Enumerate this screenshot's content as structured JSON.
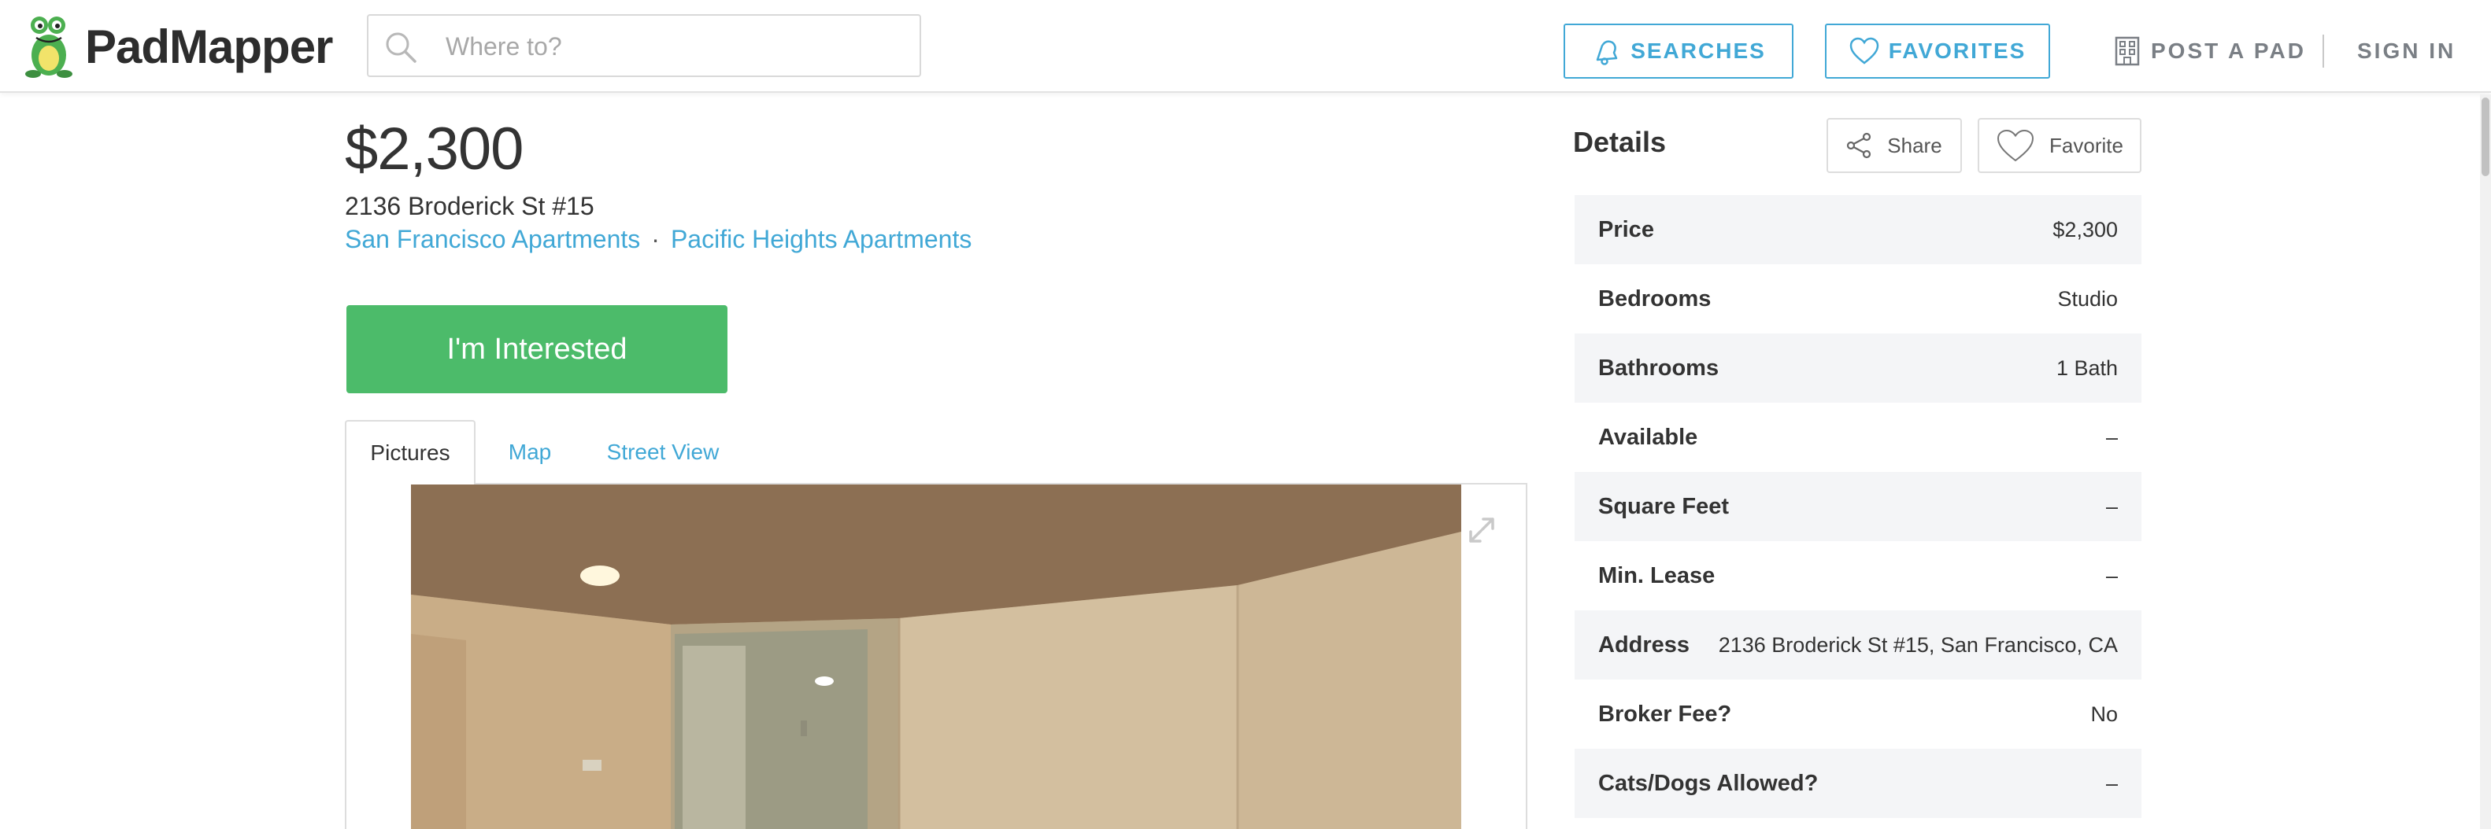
{
  "header": {
    "logo_text": "PadMapper",
    "search_placeholder": "Where to?",
    "searches_label": "SEARCHES",
    "favorites_label": "FAVORITES",
    "post_label": "POST A PAD",
    "signin_label": "SIGN IN"
  },
  "listing": {
    "price": "$2,300",
    "address": "2136 Broderick St #15",
    "crumb_city": "San Francisco Apartments",
    "crumb_separator": "·",
    "crumb_neighborhood": "Pacific Heights Apartments",
    "cta_label": "I'm Interested",
    "tabs": [
      "Pictures",
      "Map",
      "Street View"
    ]
  },
  "details": {
    "title": "Details",
    "share_label": "Share",
    "favorite_label": "Favorite",
    "rows": [
      {
        "label": "Price",
        "value": "$2,300"
      },
      {
        "label": "Bedrooms",
        "value": "Studio"
      },
      {
        "label": "Bathrooms",
        "value": "1 Bath"
      },
      {
        "label": "Available",
        "value": "–"
      },
      {
        "label": "Square Feet",
        "value": "–"
      },
      {
        "label": "Min. Lease",
        "value": "–"
      },
      {
        "label": "Address",
        "value": "2136 Broderick St #15, San Francisco, CA"
      },
      {
        "label": "Broker Fee?",
        "value": "No"
      },
      {
        "label": "Cats/Dogs Allowed?",
        "value": "–"
      }
    ]
  },
  "colors": {
    "accent": "#41a8d6",
    "cta": "#4cbb6a"
  }
}
